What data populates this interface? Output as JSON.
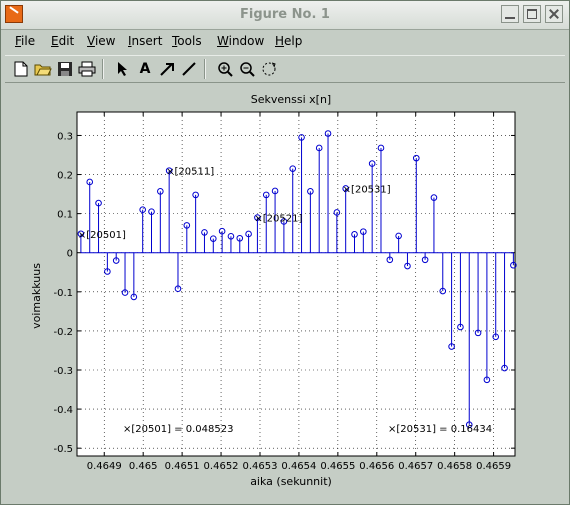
{
  "window": {
    "title": "Figure No. 1",
    "menus": [
      "File",
      "Edit",
      "View",
      "Insert",
      "Tools",
      "Window",
      "Help"
    ],
    "toolbar_icons": [
      "new-file-icon",
      "open-folder-icon",
      "save-icon",
      "print-icon",
      "select-arrow-icon",
      "insert-text-icon",
      "insert-arrow-icon",
      "insert-line-icon",
      "zoom-in-icon",
      "zoom-out-icon",
      "rotate-3d-icon"
    ]
  },
  "chart_data": {
    "type": "stem",
    "title": "Sekvenssi x[n]",
    "xlabel": "aika (sekunnit)",
    "ylabel": "voimakkuus",
    "xlim": [
      0.46483,
      0.465955
    ],
    "ylim": [
      -0.52,
      0.36
    ],
    "xticks": [
      0.4649,
      0.465,
      0.4651,
      0.4652,
      0.4653,
      0.4654,
      0.4655,
      0.4656,
      0.4657,
      0.4658,
      0.4659
    ],
    "xtick_labels": [
      "0.4649",
      "0.465",
      "0.4651",
      "0.4652",
      "0.4653",
      "0.4654",
      "0.4655",
      "0.4656",
      "0.4657",
      "0.4658",
      "0.4659"
    ],
    "yticks": [
      -0.5,
      -0.4,
      -0.3,
      -0.2,
      -0.1,
      0,
      0.1,
      0.2,
      0.3
    ],
    "ytick_labels": [
      "-0.5",
      "-0.4",
      "-0.3",
      "-0.2",
      "-0.1",
      "0",
      "0.1",
      "0.2",
      "0.3"
    ],
    "grid": true,
    "x_start": 0.46484,
    "x_step": 2.267e-05,
    "values": [
      0.048523,
      0.181,
      0.127,
      -0.048,
      -0.02,
      -0.102,
      -0.113,
      0.11,
      0.105,
      0.157,
      0.21,
      -0.092,
      0.07,
      0.148,
      0.052,
      0.036,
      0.055,
      0.042,
      0.037,
      0.048,
      0.09,
      0.148,
      0.158,
      0.08,
      0.215,
      0.295,
      0.157,
      0.268,
      0.305,
      0.103,
      0.16434,
      0.047,
      0.054,
      0.228,
      0.268,
      -0.018,
      0.043,
      -0.034,
      0.242,
      -0.018,
      0.141,
      -0.098,
      -0.24,
      -0.19,
      -0.44,
      -0.205,
      -0.325,
      -0.215,
      -0.295,
      -0.032
    ],
    "series_color": "#0000d0",
    "marker_labels": [
      {
        "index": 0,
        "text": "[20501]"
      },
      {
        "index": 10,
        "text": "[20511]"
      },
      {
        "index": 20,
        "text": "[20521]"
      },
      {
        "index": 30,
        "text": "[20531]"
      }
    ],
    "annotations": [
      {
        "text": "[20501] = 0.048523"
      },
      {
        "text": "[20531] = 0.16434"
      }
    ]
  }
}
